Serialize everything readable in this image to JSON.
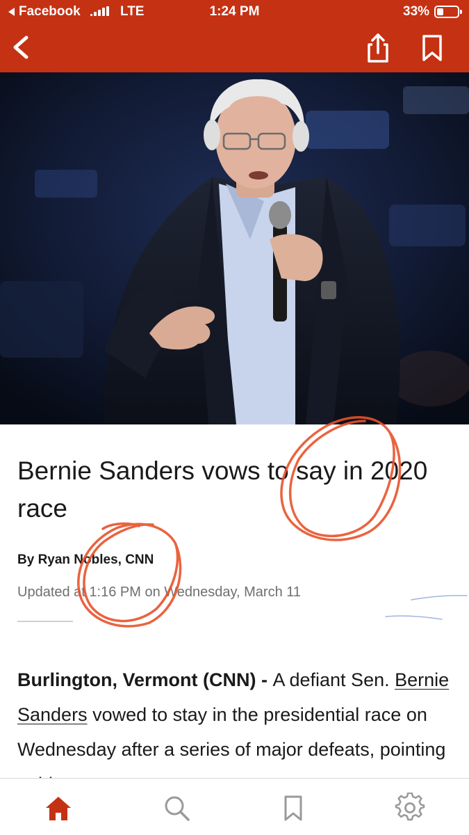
{
  "status_bar": {
    "back_app": "Facebook",
    "network": "LTE",
    "time": "1:24 PM",
    "battery_percent": "33%",
    "battery_level": 0.33,
    "signal_bars": 4
  },
  "nav": {
    "back_icon": "chevron-left-icon",
    "share_icon": "share-icon",
    "bookmark_icon": "bookmark-icon"
  },
  "article": {
    "headline": "Bernie Sanders vows to say in 2020 race",
    "byline": "By Ryan Nobles, CNN",
    "updated": "Updated at 1:16 PM on Wednesday, March 11",
    "body_lead": "Burlington, Vermont  (CNN) - ",
    "body_intro": "A defiant Sen. ",
    "body_link": "Bernie Sanders",
    "body_rest": " vowed to stay in the presidential race on Wednesday after a series of major defeats, pointing to his"
  },
  "tabbar": {
    "tabs": [
      {
        "name": "home",
        "icon": "home-icon",
        "active": true
      },
      {
        "name": "search",
        "icon": "search-icon",
        "active": false
      },
      {
        "name": "saved",
        "icon": "bookmark-icon",
        "active": false
      },
      {
        "name": "settings",
        "icon": "gear-icon",
        "active": false
      }
    ]
  },
  "colors": {
    "brand_red": "#c53113",
    "annotation_orange": "#e8522a",
    "tab_active": "#c53113",
    "tab_inactive": "#9a9a9a"
  }
}
